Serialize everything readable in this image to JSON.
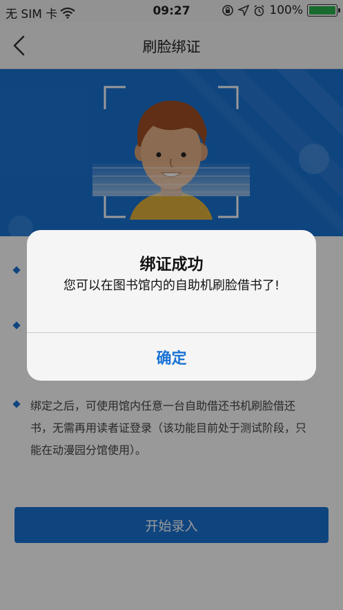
{
  "status_bar": {
    "carrier": "无 SIM 卡",
    "time": "09:27",
    "battery": "100%"
  },
  "nav": {
    "title": "刷脸绑证"
  },
  "bullets": [
    "",
    "",
    "绑定之后，可使用馆内任意一台自助借还书机刷脸借还书，无需再用读者证登录（该功能目前处于测试阶段，只能在动漫园分馆使用）。"
  ],
  "start_button": {
    "label": "开始录入"
  },
  "dialog": {
    "title": "绑证成功",
    "message": "您可以在图书馆内的自助机刷脸借书了!",
    "confirm_label": "确定"
  },
  "colors": {
    "accent": "#1a73d4",
    "battery": "#2bb24c"
  }
}
